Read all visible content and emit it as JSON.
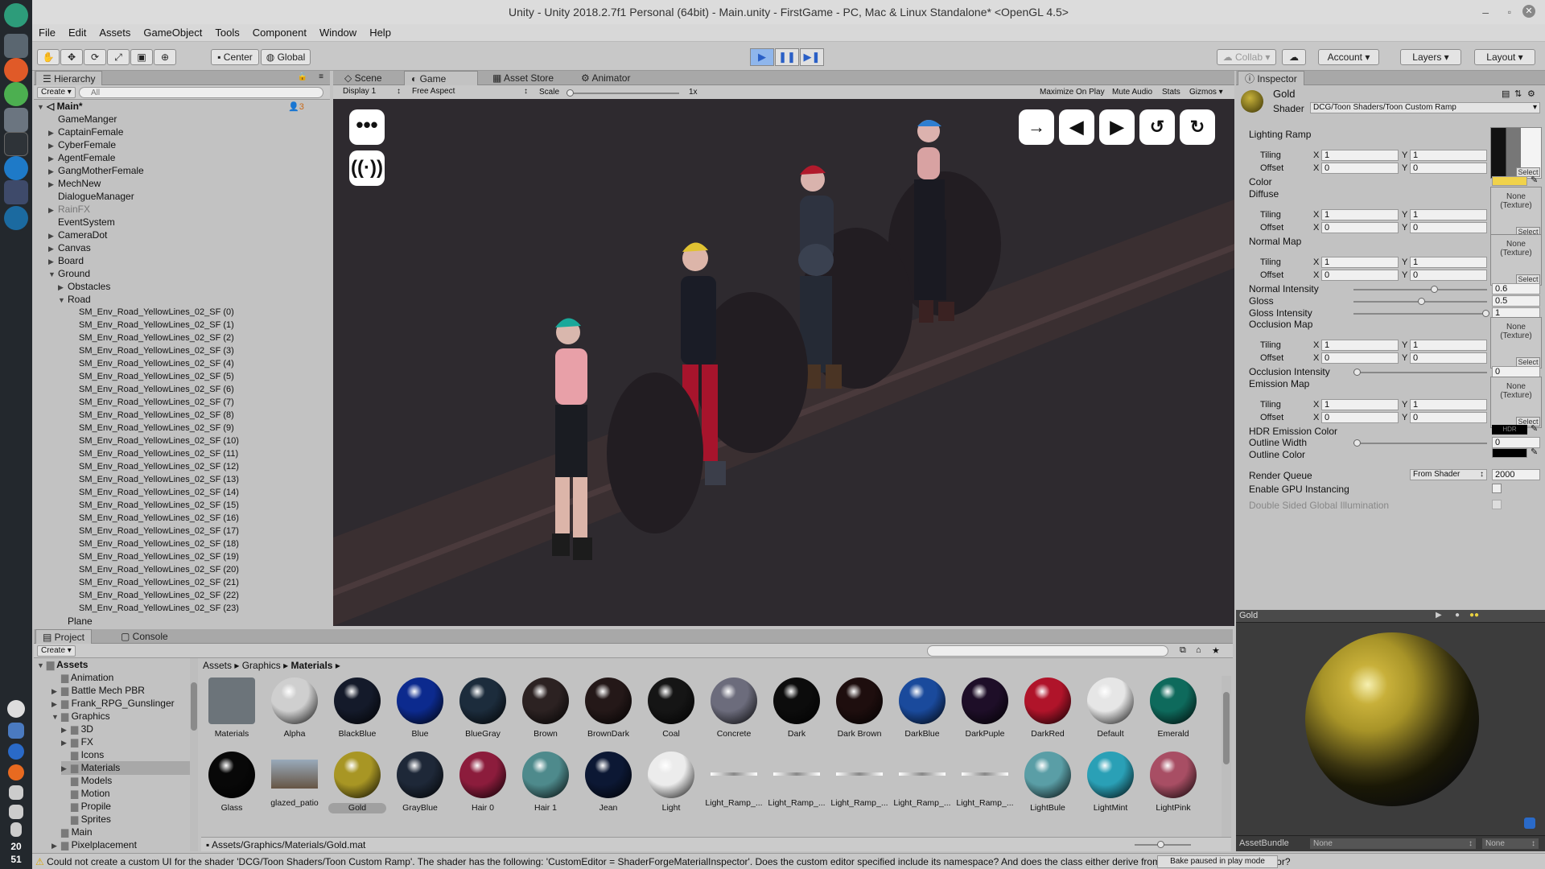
{
  "window": {
    "title": "Unity - Unity 2018.2.7f1 Personal (64bit) - Main.unity - FirstGame - PC, Mac & Linux Standalone* <OpenGL 4.5>"
  },
  "menu": [
    "File",
    "Edit",
    "Assets",
    "GameObject",
    "Tools",
    "Component",
    "Window",
    "Help"
  ],
  "toolbar": {
    "center": "Center",
    "global": "Global",
    "collab": "Collab",
    "account": "Account",
    "layers": "Layers",
    "layout": "Layout"
  },
  "hierarchy": {
    "tab": "Hierarchy",
    "create": "Create",
    "search_placeholder": "All",
    "scene": "Main*",
    "count": "3",
    "items": [
      "GameManger",
      "CaptainFemale",
      "CyberFemale",
      "AgentFemale",
      "GangMotherFemale",
      "MechNew",
      "DialogueManager",
      "RainFX",
      "EventSystem",
      "CameraDot",
      "Canvas",
      "Board",
      "Ground",
      "Obstacles",
      "Road"
    ],
    "road_children": [
      "SM_Env_Road_YellowLines_02_SF (0)",
      "SM_Env_Road_YellowLines_02_SF (1)",
      "SM_Env_Road_YellowLines_02_SF (2)",
      "SM_Env_Road_YellowLines_02_SF (3)",
      "SM_Env_Road_YellowLines_02_SF (4)",
      "SM_Env_Road_YellowLines_02_SF (5)",
      "SM_Env_Road_YellowLines_02_SF (6)",
      "SM_Env_Road_YellowLines_02_SF (7)",
      "SM_Env_Road_YellowLines_02_SF (8)",
      "SM_Env_Road_YellowLines_02_SF (9)",
      "SM_Env_Road_YellowLines_02_SF (10)",
      "SM_Env_Road_YellowLines_02_SF (11)",
      "SM_Env_Road_YellowLines_02_SF (12)",
      "SM_Env_Road_YellowLines_02_SF (13)",
      "SM_Env_Road_YellowLines_02_SF (14)",
      "SM_Env_Road_YellowLines_02_SF (15)",
      "SM_Env_Road_YellowLines_02_SF (16)",
      "SM_Env_Road_YellowLines_02_SF (17)",
      "SM_Env_Road_YellowLines_02_SF (18)",
      "SM_Env_Road_YellowLines_02_SF (19)",
      "SM_Env_Road_YellowLines_02_SF (20)",
      "SM_Env_Road_YellowLines_02_SF (21)",
      "SM_Env_Road_YellowLines_02_SF (22)",
      "SM_Env_Road_YellowLines_02_SF (23)"
    ],
    "last": "Plane"
  },
  "game": {
    "tabs": [
      "Scene",
      "Game",
      "Asset Store",
      "Animator"
    ],
    "display": "Display 1",
    "aspect": "Free Aspect",
    "scale_label": "Scale",
    "scale_value": "1x",
    "options": [
      "Maximize On Play",
      "Mute Audio",
      "Stats",
      "Gizmos"
    ]
  },
  "inspector": {
    "tab": "Inspector",
    "material": "Gold",
    "shader_label": "Shader",
    "shader": "DCG/Toon Shaders/Toon Custom Ramp",
    "lighting_ramp": "Lighting Ramp",
    "tiling": "Tiling",
    "offset": "Offset",
    "x": "X",
    "y": "Y",
    "one": "1",
    "zero": "0",
    "select": "Select",
    "none_texture": "None (Texture)",
    "color": "Color",
    "diffuse": "Diffuse",
    "normal_map": "Normal Map",
    "normal_intensity": "Normal Intensity",
    "normal_intensity_val": "0.6",
    "gloss": "Gloss",
    "gloss_val": "0.5",
    "gloss_intensity": "Gloss Intensity",
    "gloss_intensity_val": "1",
    "occlusion_map": "Occlusion Map",
    "occlusion_intensity": "Occlusion Intensity",
    "occlusion_intensity_val": "0",
    "emission_map": "Emission Map",
    "hdr_emission": "HDR Emission Color",
    "hdr": "HDR",
    "outline_width": "Outline Width",
    "outline_width_val": "0",
    "outline_color": "Outline Color",
    "render_queue": "Render Queue",
    "render_queue_mode": "From Shader",
    "render_queue_val": "2000",
    "gpu_instancing": "Enable GPU Instancing",
    "double_sided": "Double Sided Global Illumination",
    "slider_levels": {
      "normal_intensity": 0.6,
      "gloss": 0.5,
      "gloss_intensity": 1.0,
      "occlusion_intensity": 0.0,
      "outline_width": 0.0
    }
  },
  "preview": {
    "title": "Gold",
    "assetbundle": "AssetBundle",
    "none1": "None",
    "none2": "None"
  },
  "project": {
    "tabs": [
      "Project",
      "Console"
    ],
    "create": "Create",
    "folders": [
      {
        "name": "Assets"
      },
      {
        "name": "Animation"
      },
      {
        "name": "Battle Mech PBR"
      },
      {
        "name": "Frank_RPG_Gunslinger"
      },
      {
        "name": "Graphics"
      },
      {
        "name": "3D"
      },
      {
        "name": "FX"
      },
      {
        "name": "Icons"
      },
      {
        "name": "Materials"
      },
      {
        "name": "Models"
      },
      {
        "name": "Motion"
      },
      {
        "name": "Propile"
      },
      {
        "name": "Sprites"
      },
      {
        "name": "Main"
      },
      {
        "name": "Pixelplacement"
      }
    ],
    "breadcrumb": [
      "Assets",
      "Graphics",
      "Materials"
    ],
    "assets_row1": [
      {
        "name": "Materials",
        "color": "#6c747a"
      },
      {
        "name": "Alpha",
        "color": "#cfcfcf"
      },
      {
        "name": "BlackBlue",
        "color": "#141a2a"
      },
      {
        "name": "Blue",
        "color": "#0c2a8e"
      },
      {
        "name": "BlueGray",
        "color": "#1c2c3c"
      },
      {
        "name": "Brown",
        "color": "#2c2222"
      },
      {
        "name": "BrownDark",
        "color": "#241818"
      },
      {
        "name": "Coal",
        "color": "#151515"
      },
      {
        "name": "Concrete",
        "color": "#6c6c7c"
      },
      {
        "name": "Dark",
        "color": "#0c0c0c"
      },
      {
        "name": "Dark Brown",
        "color": "#1e0e0e"
      },
      {
        "name": "DarkBlue",
        "color": "#1a4a9c"
      },
      {
        "name": "DarkPuple",
        "color": "#1e0e28"
      },
      {
        "name": "DarkRed",
        "color": "#b0142a"
      },
      {
        "name": "Default",
        "color": "#e6e6e6"
      },
      {
        "name": "Emerald",
        "color": "#0e6a5c"
      }
    ],
    "assets_row2": [
      {
        "name": "Glass",
        "color": "#080808"
      },
      {
        "name": "glazed_patio",
        "color": "#8a8a8a"
      },
      {
        "name": "Gold",
        "color": "#a89624"
      },
      {
        "name": "GrayBlue",
        "color": "#1e2838"
      },
      {
        "name": "Hair 0",
        "color": "#8c1c3c"
      },
      {
        "name": "Hair 1",
        "color": "#4e8a8c"
      },
      {
        "name": "Jean",
        "color": "#0c1834"
      },
      {
        "name": "Light",
        "color": "#ececec"
      },
      {
        "name": "Light_Ramp_...",
        "color": "ramp"
      },
      {
        "name": "Light_Ramp_...",
        "color": "ramp"
      },
      {
        "name": "Light_Ramp_...",
        "color": "ramp"
      },
      {
        "name": "Light_Ramp_...",
        "color": "ramp"
      },
      {
        "name": "Light_Ramp_...",
        "color": "ramp"
      },
      {
        "name": "LightBule",
        "color": "#5a9ea6"
      },
      {
        "name": "LightMint",
        "color": "#2aa0b6"
      },
      {
        "name": "LightPink",
        "color": "#a84e64"
      }
    ],
    "path": "Assets/Graphics/Materials/Gold.mat"
  },
  "status": {
    "message": "Could not create a custom UI for the shader 'DCG/Toon Shaders/Toon Custom Ramp'. The shader has the following: 'CustomEditor = ShaderForgeMaterialInspector'. Does the custom editor specified include its namespace? And does the class either derive from ShaderGUI or MaterialEditor?",
    "bake": "Bake paused in play mode"
  },
  "clock": {
    "hour": "20",
    "minute": "51"
  }
}
